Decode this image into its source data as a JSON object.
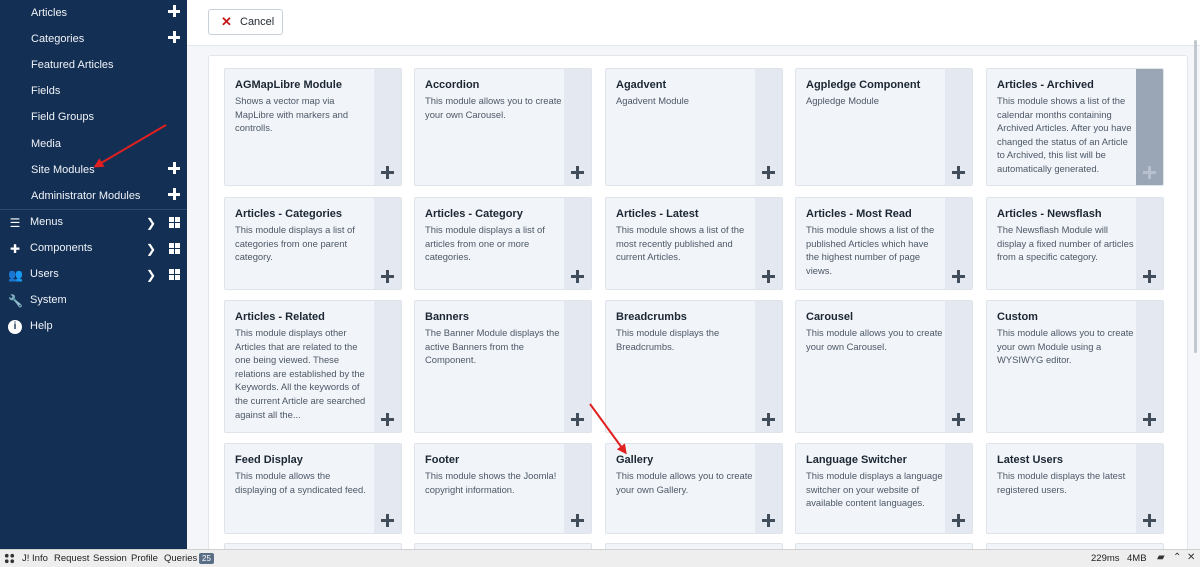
{
  "sidebar": {
    "content_items": [
      {
        "label": "Articles",
        "has_add": true
      },
      {
        "label": "Categories",
        "has_add": true
      },
      {
        "label": "Featured Articles",
        "has_add": false
      },
      {
        "label": "Fields",
        "has_add": false
      },
      {
        "label": "Field Groups",
        "has_add": false
      },
      {
        "label": "Media",
        "has_add": false
      },
      {
        "label": "Site Modules",
        "has_add": true
      },
      {
        "label": "Administrator Modules",
        "has_add": true
      }
    ],
    "main_items": [
      {
        "label": "Menus",
        "icon": "list-icon"
      },
      {
        "label": "Components",
        "icon": "puzzle-icon"
      },
      {
        "label": "Users",
        "icon": "users-icon"
      },
      {
        "label": "System",
        "icon": "wrench-icon"
      },
      {
        "label": "Help",
        "icon": "info-icon"
      }
    ]
  },
  "toolbar": {
    "cancel_label": "Cancel"
  },
  "modules": [
    {
      "title": "AGMapLibre Module",
      "desc": "Shows a vector map via MapLibre with markers and controlls."
    },
    {
      "title": "Accordion",
      "desc": "This module allows you to create your own Carousel."
    },
    {
      "title": "Agadvent",
      "desc": "Agadvent Module"
    },
    {
      "title": "Agpledge Component",
      "desc": "Agpledge Module"
    },
    {
      "title": "Articles - Archived",
      "desc": "This module shows a list of the calendar months containing Archived Articles. After you have changed the status of an Article to Archived, this list will be automatically generated."
    },
    {
      "title": "Articles - Categories",
      "desc": "This module displays a list of categories from one parent category."
    },
    {
      "title": "Articles - Category",
      "desc": "This module displays a list of articles from one or more categories."
    },
    {
      "title": "Articles - Latest",
      "desc": "This module shows a list of the most recently published and current Articles."
    },
    {
      "title": "Articles - Most Read",
      "desc": "This module shows a list of the published Articles which have the highest number of page views."
    },
    {
      "title": "Articles - Newsflash",
      "desc": "The Newsflash Module will display a fixed number of articles from a specific category."
    },
    {
      "title": "Articles - Related",
      "desc": "This module displays other Articles that are related to the one being viewed. These relations are established by the Keywords. All the keywords of the current Article are searched against all the..."
    },
    {
      "title": "Banners",
      "desc": "The Banner Module displays the active Banners from the Component."
    },
    {
      "title": "Breadcrumbs",
      "desc": "This module displays the Breadcrumbs."
    },
    {
      "title": "Carousel",
      "desc": "This module allows you to create your own Carousel."
    },
    {
      "title": "Custom",
      "desc": "This module allows you to create your own Module using a WYSIWYG editor."
    },
    {
      "title": "Feed Display",
      "desc": "This module allows the displaying of a syndicated feed."
    },
    {
      "title": "Footer",
      "desc": "This module shows the Joomla! copyright information."
    },
    {
      "title": "Gallery",
      "desc": "This module allows you to create your own Gallery."
    },
    {
      "title": "Language Switcher",
      "desc": "This module displays a language switcher on your website of available content languages."
    },
    {
      "title": "Latest Users",
      "desc": "This module displays the latest registered users."
    }
  ],
  "debugbar": {
    "info": "J! Info",
    "request": "Request",
    "session": "Session",
    "profile": "Profile",
    "queries": "Queries",
    "queries_count": "25",
    "time": "229ms",
    "memory": "4MB"
  },
  "colors": {
    "sidebar_bg": "#132f53",
    "card_bg": "#f1f4f9",
    "cancel_icon": "#c41a1a",
    "annotation_arrow": "#e02020"
  }
}
